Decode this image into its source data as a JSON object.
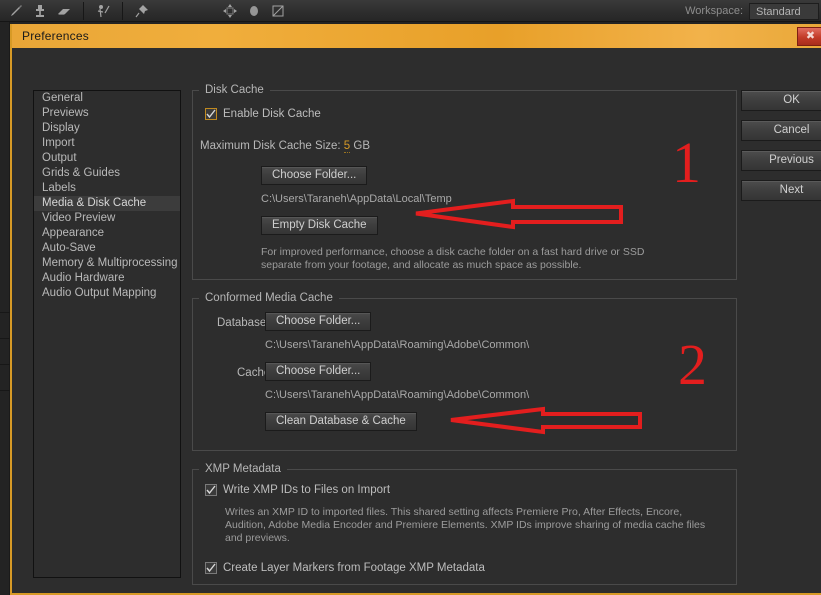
{
  "app": {
    "workspace_label": "Workspace:",
    "workspace_value": "Standard",
    "tools": [
      {
        "name": "brush-icon",
        "title": "Brush Tool"
      },
      {
        "name": "clone-stamp-icon",
        "title": "Clone Stamp Tool"
      },
      {
        "name": "eraser-icon",
        "title": "Eraser Tool"
      },
      {
        "name": "roto-brush-icon",
        "title": "Roto Brush Tool"
      },
      {
        "name": "puppet-pin-icon",
        "title": "Puppet Pin Tool"
      },
      {
        "name": "move-anchor-icon",
        "title": "Pan Behind Tool"
      },
      {
        "name": "ellipse-mask-icon",
        "title": "Shape Tool"
      },
      {
        "name": "mask-feather-icon",
        "title": "Mask Feather Tool"
      }
    ]
  },
  "dialog": {
    "title": "Preferences",
    "close_glyph": "✖"
  },
  "sidebar": {
    "items": [
      {
        "label": "General",
        "selected": false
      },
      {
        "label": "Previews",
        "selected": false
      },
      {
        "label": "Display",
        "selected": false
      },
      {
        "label": "Import",
        "selected": false
      },
      {
        "label": "Output",
        "selected": false
      },
      {
        "label": "Grids & Guides",
        "selected": false
      },
      {
        "label": "Labels",
        "selected": false
      },
      {
        "label": "Media & Disk Cache",
        "selected": true
      },
      {
        "label": "Video Preview",
        "selected": false
      },
      {
        "label": "Appearance",
        "selected": false
      },
      {
        "label": "Auto-Save",
        "selected": false
      },
      {
        "label": "Memory & Multiprocessing",
        "selected": false
      },
      {
        "label": "Audio Hardware",
        "selected": false
      },
      {
        "label": "Audio Output Mapping",
        "selected": false
      }
    ]
  },
  "disk_cache": {
    "legend": "Disk Cache",
    "enable_checkbox_label": "Enable Disk Cache",
    "enable_checked": true,
    "max_size_label": "Maximum Disk Cache Size:",
    "max_size_value": "5",
    "max_size_unit": "GB",
    "choose_folder_button": "Choose Folder...",
    "folder_path": "C:\\Users\\Taraneh\\AppData\\Local\\Temp",
    "empty_cache_button": "Empty Disk Cache",
    "description": "For improved performance, choose a disk cache folder on a fast hard drive or SSD separate from your footage, and allocate as much space as possible."
  },
  "conformed_media_cache": {
    "legend": "Conformed Media Cache",
    "database_label": "Database:",
    "database_button": "Choose Folder...",
    "database_path": "C:\\Users\\Taraneh\\AppData\\Roaming\\Adobe\\Common\\",
    "cache_label": "Cache:",
    "cache_button": "Choose Folder...",
    "cache_path": "C:\\Users\\Taraneh\\AppData\\Roaming\\Adobe\\Common\\",
    "clean_button": "Clean Database & Cache"
  },
  "xmp_metadata": {
    "legend": "XMP Metadata",
    "write_ids_label": "Write XMP IDs to Files on Import",
    "write_ids_checked": true,
    "write_ids_description": "Writes an XMP ID to imported files. This shared setting affects Premiere Pro, After Effects, Encore, Audition, Adobe Media Encoder and Premiere Elements. XMP IDs improve sharing of media cache files and previews.",
    "layer_markers_label": "Create Layer Markers from Footage XMP Metadata",
    "layer_markers_checked": true
  },
  "actions": {
    "ok": "OK",
    "cancel": "Cancel",
    "previous": "Previous",
    "next": "Next"
  },
  "annotations": {
    "marker_one": "1",
    "marker_two": "2",
    "color": "#e31e1e"
  }
}
